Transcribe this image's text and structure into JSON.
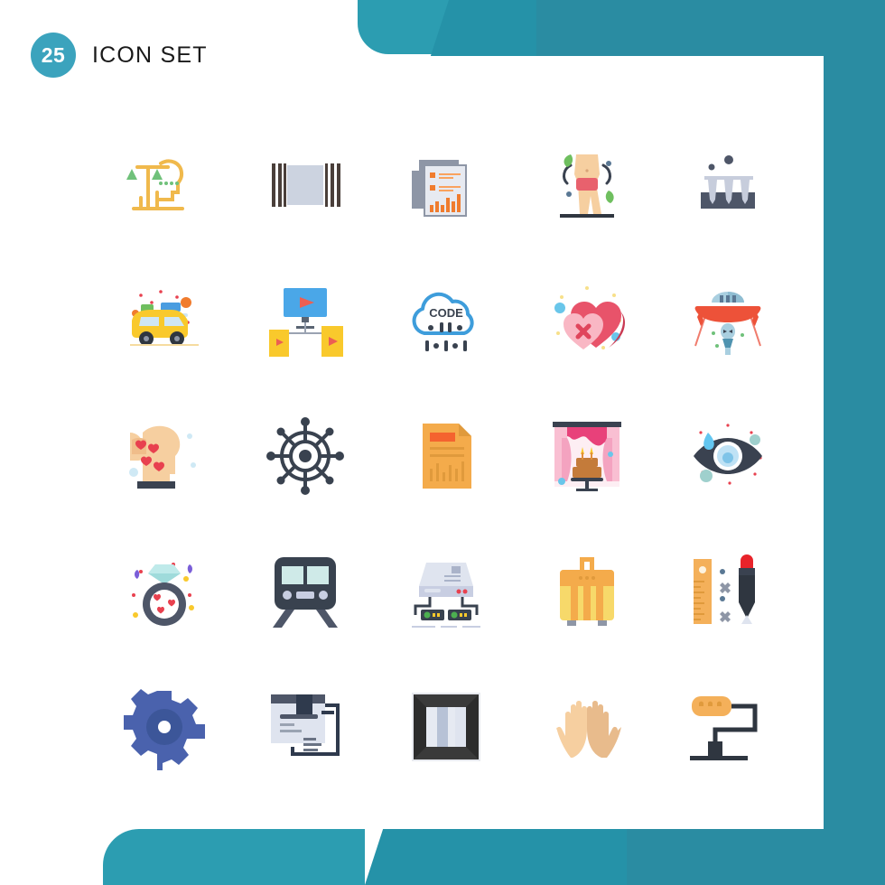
{
  "header": {
    "count": "25",
    "title": "Icon Set"
  },
  "theme": {
    "band_light": "#2c9db1",
    "band_mid": "#2592a8",
    "band_dark": "#2a8ca2",
    "badge": "#3ba3bd",
    "title_color": "#1a1a1a",
    "card": "#ffffff"
  },
  "grid": {
    "columns": 5,
    "rows": 5,
    "total": 25
  },
  "icons": [
    {
      "index": 1,
      "name": "head-balance-scales-icon",
      "label": "Ethics Mind",
      "colors": [
        "#f0b94c",
        "#6fc17a"
      ]
    },
    {
      "index": 2,
      "name": "barcode-curtain-icon",
      "label": "Barcode",
      "colors": [
        "#4a3f3a",
        "#ccd3e0"
      ]
    },
    {
      "index": 3,
      "name": "report-documents-icon",
      "label": "Reports",
      "colors": [
        "#8e96a6",
        "#f07c2e"
      ]
    },
    {
      "index": 4,
      "name": "slim-body-diet-icon",
      "label": "Diet Body",
      "colors": [
        "#f6cfa0",
        "#e8616d",
        "#6fbf5f"
      ]
    },
    {
      "index": 5,
      "name": "nails-rack-icon",
      "label": "Nails",
      "colors": [
        "#4e5668",
        "#c7cddc"
      ]
    },
    {
      "index": 6,
      "name": "travel-car-icon",
      "label": "Road Trip",
      "colors": [
        "#f9c92c",
        "#4a9de0"
      ]
    },
    {
      "index": 7,
      "name": "video-distribution-icon",
      "label": "Media Share",
      "colors": [
        "#4aa7e8",
        "#f9c92c",
        "#ec5f52"
      ]
    },
    {
      "index": 8,
      "name": "cloud-code-icon",
      "label": "Cloud Code",
      "text": "CODE",
      "colors": [
        "#3e9ddb",
        "#39424f"
      ]
    },
    {
      "index": 9,
      "name": "broken-hearts-icon",
      "label": "Unlike",
      "colors": [
        "#e8536a",
        "#f9b7c4"
      ]
    },
    {
      "index": 10,
      "name": "ufo-alien-icon",
      "label": "UFO",
      "colors": [
        "#ed5239",
        "#a9cfe0"
      ]
    },
    {
      "index": 11,
      "name": "head-love-thoughts-icon",
      "label": "In Love",
      "colors": [
        "#f6cfa0",
        "#e8414f"
      ]
    },
    {
      "index": 12,
      "name": "ship-wheel-icon",
      "label": "Helm",
      "colors": [
        "#39424f"
      ]
    },
    {
      "index": 13,
      "name": "orange-report-file-icon",
      "label": "Chart File",
      "colors": [
        "#f4ab4b",
        "#f4632f"
      ]
    },
    {
      "index": 14,
      "name": "cake-stage-icon",
      "label": "Celebration",
      "colors": [
        "#e8417a",
        "#f9bfd2",
        "#c47b3a"
      ]
    },
    {
      "index": 15,
      "name": "crying-eye-icon",
      "label": "Tear Eye",
      "colors": [
        "#3a4250",
        "#63c6f0"
      ]
    },
    {
      "index": 16,
      "name": "diamond-ring-icon",
      "label": "Engagement",
      "colors": [
        "#4e5668",
        "#9fdbdb",
        "#e8414f"
      ]
    },
    {
      "index": 17,
      "name": "train-front-icon",
      "label": "Subway",
      "colors": [
        "#39424f",
        "#cfeae8"
      ]
    },
    {
      "index": 18,
      "name": "network-server-icon",
      "label": "Server",
      "colors": [
        "#c8cee2",
        "#39424f",
        "#4caf50"
      ]
    },
    {
      "index": 19,
      "name": "suitcase-luggage-icon",
      "label": "Luggage",
      "colors": [
        "#f4ab4b",
        "#f7d96a"
      ]
    },
    {
      "index": 20,
      "name": "ruler-pen-icon",
      "label": "Design Tools",
      "colors": [
        "#f4b05a",
        "#2f3640",
        "#e8232a"
      ]
    },
    {
      "index": 21,
      "name": "gear-settings-icon",
      "label": "Settings",
      "colors": [
        "#4a62ad",
        "#3c5699"
      ]
    },
    {
      "index": 22,
      "name": "package-label-icon",
      "label": "Shipment",
      "colors": [
        "#dfe4ef",
        "#2f3a4d"
      ]
    },
    {
      "index": 23,
      "name": "picture-frame-icon",
      "label": "Frame",
      "colors": [
        "#2c2c2c",
        "#ccd3e0"
      ]
    },
    {
      "index": 24,
      "name": "open-hands-icon",
      "label": "Hands",
      "colors": [
        "#f6cfa0",
        "#e8bb8c"
      ]
    },
    {
      "index": 25,
      "name": "desk-lamp-icon",
      "label": "Desk Lamp",
      "colors": [
        "#f4b05a",
        "#2f3640"
      ]
    }
  ]
}
